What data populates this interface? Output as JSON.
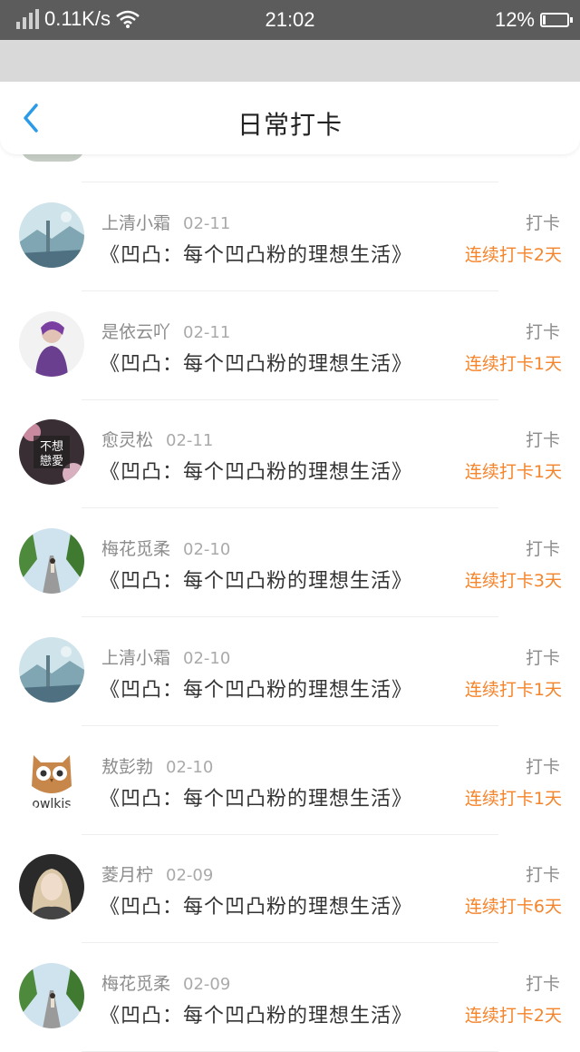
{
  "status": {
    "speed": "0.11K/s",
    "time": "21:02",
    "battery": "12%",
    "battery_level": 0.12
  },
  "header": {
    "title": "日常打卡"
  },
  "items": [
    {
      "name": "上清小霜",
      "date": "02-11",
      "book": "《凹凸：每个凹凸粉的理想生活》",
      "tag": "打卡",
      "streak": "连续打卡2天",
      "avatar": "landscape"
    },
    {
      "name": "是依云吖",
      "date": "02-11",
      "book": "《凹凸：每个凹凸粉的理想生活》",
      "tag": "打卡",
      "streak": "连续打卡1天",
      "avatar": "person"
    },
    {
      "name": "愈灵松",
      "date": "02-11",
      "book": "《凹凸：每个凹凸粉的理想生活》",
      "tag": "打卡",
      "streak": "连续打卡1天",
      "avatar": "text",
      "avatar_text": "不想戀愛"
    },
    {
      "name": "梅花觅柔",
      "date": "02-10",
      "book": "《凹凸：每个凹凸粉的理想生活》",
      "tag": "打卡",
      "streak": "连续打卡3天",
      "avatar": "road"
    },
    {
      "name": "上清小霜",
      "date": "02-10",
      "book": "《凹凸：每个凹凸粉的理想生活》",
      "tag": "打卡",
      "streak": "连续打卡1天",
      "avatar": "landscape"
    },
    {
      "name": "敖彭勃",
      "date": "02-10",
      "book": "《凹凸：每个凹凸粉的理想生活》",
      "tag": "打卡",
      "streak": "连续打卡1天",
      "avatar": "owl",
      "avatar_text": "owlkis"
    },
    {
      "name": "菱月柠",
      "date": "02-09",
      "book": "《凹凸：每个凹凸粉的理想生活》",
      "tag": "打卡",
      "streak": "连续打卡6天",
      "avatar": "portrait"
    },
    {
      "name": "梅花觅柔",
      "date": "02-09",
      "book": "《凹凸：每个凹凸粉的理想生活》",
      "tag": "打卡",
      "streak": "连续打卡2天",
      "avatar": "road"
    }
  ]
}
